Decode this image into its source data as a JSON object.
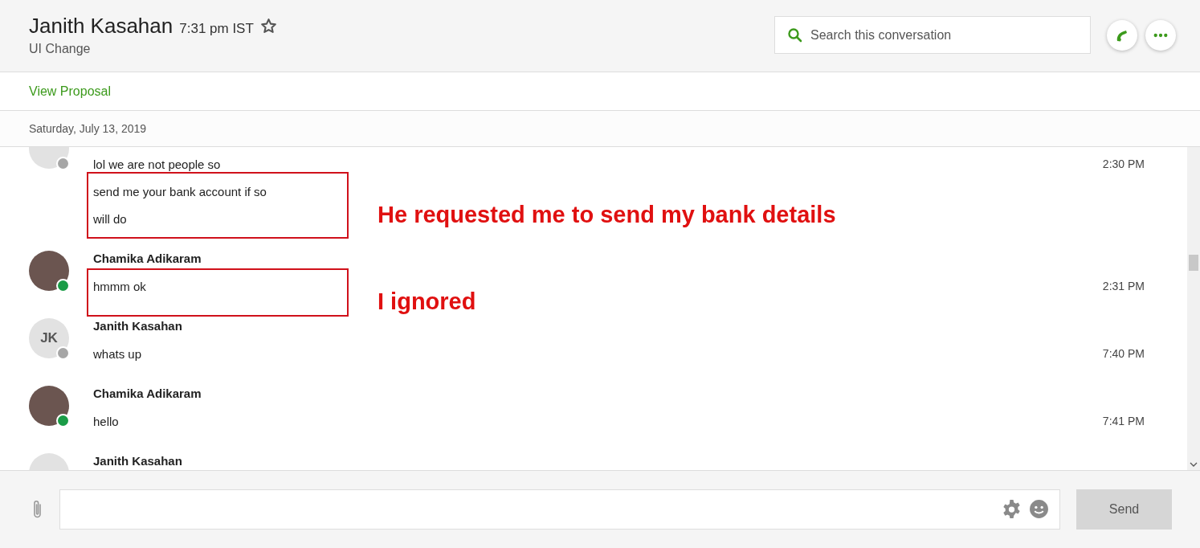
{
  "header": {
    "contact": "Janith Kasahan",
    "local_time": "7:31 pm IST",
    "starred": false,
    "subtitle": "UI Change"
  },
  "search": {
    "placeholder": "Search this conversation"
  },
  "proposal_link": "View Proposal",
  "date": "Saturday, July 13, 2019",
  "groups": [
    {
      "kind": "initials",
      "online": false,
      "messages": [
        "lol we are not people so",
        "send me your bank account if so",
        "will do"
      ],
      "time": "2:30 PM"
    },
    {
      "kind": "photo",
      "online": true,
      "name": "Chamika Adikaram",
      "messages": [
        "hmmm ok"
      ],
      "time": "2:31 PM"
    },
    {
      "kind": "initials",
      "initials": "JK",
      "online": false,
      "name": "Janith Kasahan",
      "messages": [
        "whats up"
      ],
      "time": "7:40 PM"
    },
    {
      "kind": "photo",
      "online": true,
      "name": "Chamika Adikaram",
      "messages": [
        "hello"
      ],
      "time": "7:41 PM"
    },
    {
      "kind": "initials",
      "name": "Janith Kasahan"
    }
  ],
  "annotations": [
    "He requested me to send my bank details",
    "I ignored"
  ],
  "composer": {
    "send": "Send"
  }
}
